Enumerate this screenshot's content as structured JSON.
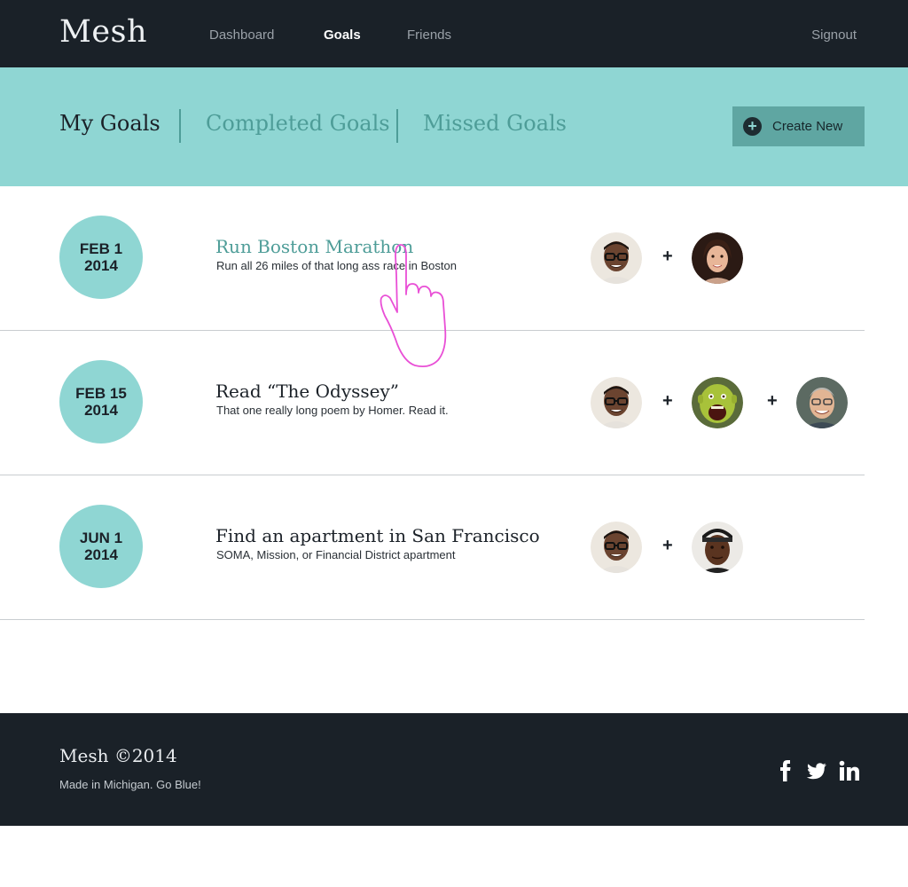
{
  "header": {
    "logo": "Mesh",
    "nav": [
      {
        "label": "Dashboard",
        "active": false
      },
      {
        "label": "Goals",
        "active": true
      },
      {
        "label": "Friends",
        "active": false
      }
    ],
    "signout": "Signout"
  },
  "subheader": {
    "tabs": [
      {
        "label": "My Goals",
        "active": true
      },
      {
        "label": "Completed Goals",
        "active": false
      },
      {
        "label": "Missed Goals",
        "active": false
      }
    ],
    "create_label": "Create New",
    "create_icon": "plus-circle-icon"
  },
  "goals": [
    {
      "month_day": "FEB 1",
      "year": "2014",
      "title": "Run Boston Marathon",
      "description": "Run all 26 miles of that long ass race in Boston",
      "participants": [
        "man-glasses-avatar",
        "woman-avatar"
      ]
    },
    {
      "month_day": "FEB 15",
      "year": "2014",
      "title": "Read “The Odyssey”",
      "description": "That one really long poem by Homer. Read it.",
      "participants": [
        "man-glasses-avatar",
        "green-ogre-avatar",
        "older-man-avatar"
      ]
    },
    {
      "month_day": "JUN 1",
      "year": "2014",
      "title": "Find an apartment in San Francisco",
      "description": "SOMA, Mission, or Financial District apartment",
      "participants": [
        "man-glasses-avatar",
        "man-cap-avatar"
      ]
    }
  ],
  "plus_symbol": "+",
  "footer": {
    "brand": "Mesh ©2014",
    "tagline": "Made in Michigan. Go Blue!",
    "social": [
      "facebook-icon",
      "twitter-icon",
      "linkedin-icon"
    ]
  },
  "colors": {
    "dark": "#1a2128",
    "teal": "#8fd6d3",
    "teal_dark": "#4e9d98",
    "button": "#5fa6a2",
    "cursor": "#e94fd6"
  }
}
